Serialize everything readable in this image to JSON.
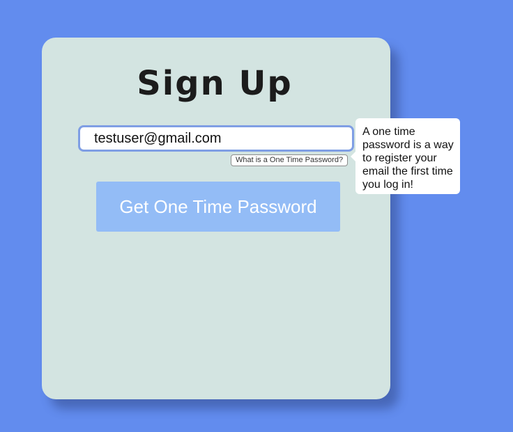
{
  "signup": {
    "title": "Sign Up",
    "email_value": "testuser@gmail.com",
    "otp_help_link": "What is a One Time Password?",
    "submit_label": "Get One Time Password"
  },
  "tooltip": {
    "text": "A one time password is a way to register your email the first time you log in!"
  },
  "colors": {
    "background": "#628cee",
    "card": "#d3e4e1",
    "button": "#93bcf6",
    "input_border": "#7f9ee4"
  }
}
